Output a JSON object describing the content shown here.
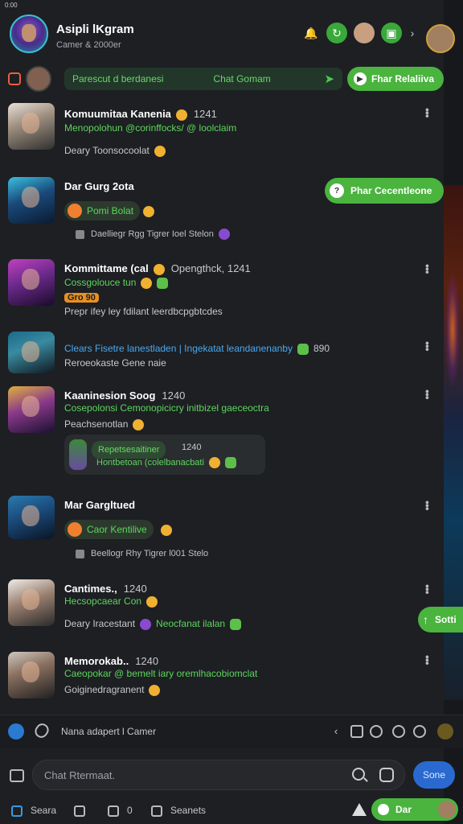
{
  "status": {
    "time": "0:00"
  },
  "header": {
    "title": "Asipli lKgram",
    "subtitle": "Camer & 2000er"
  },
  "pinned": {
    "text": "Parescut d berdanesi",
    "label": "Chat Gomam",
    "button": "Fhar Relaliiva"
  },
  "messages": [
    {
      "name": "Komuumitaa Kanenia",
      "meta": "1241",
      "line1": "Menopolohun @corinffocks/ @ loolclaim",
      "line2": "Deary Toonsocoolat"
    },
    {
      "name": "Dar Gurg 2ota",
      "pill": "Pomi Bolat",
      "sub": "Daelliegr Rgg Tigrer Ioel Stelon"
    },
    {
      "name": "Kommittame (cal",
      "meta": "Opengthck, 1241",
      "line1": "Cossgolouce tun",
      "tag": "Gro 90",
      "line2": "Prepr ifey ley fdilant leerdbcpgbtcdes"
    },
    {
      "line1": "Clears Fisetre lanestladen | Ingekatat leandanenanby",
      "meta": "890",
      "line2": "Reroeokaste Gene naie"
    },
    {
      "name": "Kaaninesion Soog",
      "meta": "1240",
      "line1": "Cosepolonsi Cemonopicicry initbizel gaeceoctra",
      "line2": "Peachsenotlan",
      "reply_head": "Repetsesaitiner",
      "reply_time": "1240",
      "reply_text": "Hontbetoan (colelbanacbati"
    },
    {
      "name": "Mar Gargltued",
      "pill": "Caor Kentilive",
      "sub": "Beellogr Rhy Tigrer l001 Stelo"
    },
    {
      "name": "Cantimes.,",
      "meta": "1240",
      "line1": "Hecsopcaear Con",
      "line2": "Deary Iracestant",
      "line2_green": "Neocfanat ilalan"
    },
    {
      "name": "Memorokab..",
      "meta": "1240",
      "line1": "Caeopokar @ bemelt iary oremlhacobiomclat",
      "line2": "Goiginedragranent"
    }
  ],
  "floating": {
    "chat_button": "Phar Cecentleone",
    "side_button": "Sotti"
  },
  "toolbar": {
    "text": "Nana adapert l Camer"
  },
  "composer": {
    "placeholder": "Chat Rtermaat.",
    "send": "Sone"
  },
  "nav": {
    "item1": "Seara",
    "item2": "0",
    "item3": "Seanets",
    "pill": "Dar"
  },
  "colors": {
    "accent_green": "#4ab43e",
    "text_green": "#5cd65c",
    "link_blue": "#4aa8f0",
    "background": "#1d1f23",
    "send_blue": "#2a6ad0"
  }
}
